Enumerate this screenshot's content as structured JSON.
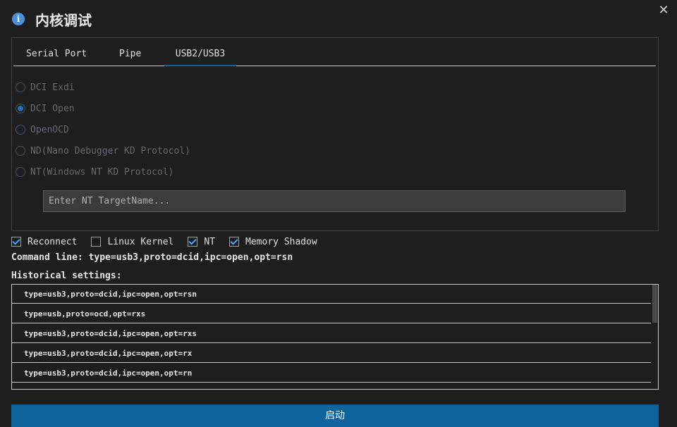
{
  "window": {
    "title": "内核调试",
    "close_glyph": "✕"
  },
  "tabs": [
    {
      "label": "Serial Port"
    },
    {
      "label": "Pipe"
    },
    {
      "label": "USB2/USB3"
    }
  ],
  "active_tab": 2,
  "radios": [
    {
      "label": "DCI Exdi",
      "checked": false
    },
    {
      "label": "DCI Open",
      "checked": true
    },
    {
      "label": "OpenOCD",
      "checked": false
    },
    {
      "label": "ND(Nano Debugger KD Protocol)",
      "checked": false
    },
    {
      "label": "NT(Windows NT KD Protocol)",
      "checked": false
    }
  ],
  "target_input": {
    "value": "",
    "placeholder": "Enter NT TargetName..."
  },
  "checkboxes": [
    {
      "label": "Reconnect",
      "checked": true
    },
    {
      "label": "Linux Kernel",
      "checked": false
    },
    {
      "label": "NT",
      "checked": true
    },
    {
      "label": "Memory Shadow",
      "checked": true
    }
  ],
  "command_line": "Command line: type=usb3,proto=dcid,ipc=open,opt=rsn",
  "history": {
    "label": "Historical settings:",
    "items": [
      "type=usb3,proto=dcid,ipc=open,opt=rsn",
      "type=usb,proto=ocd,opt=rxs",
      "type=usb3,proto=dcid,ipc=open,opt=rxs",
      "type=usb3,proto=dcid,ipc=open,opt=rx",
      "type=usb3,proto=dcid,ipc=open,opt=rn"
    ]
  },
  "start_button": {
    "label": "启动"
  },
  "colors": {
    "accent": "#0e639c",
    "info": "#4a8fdc",
    "background": "#1e1e1e"
  },
  "icons": {
    "info": "info-icon",
    "close": "close-icon"
  }
}
